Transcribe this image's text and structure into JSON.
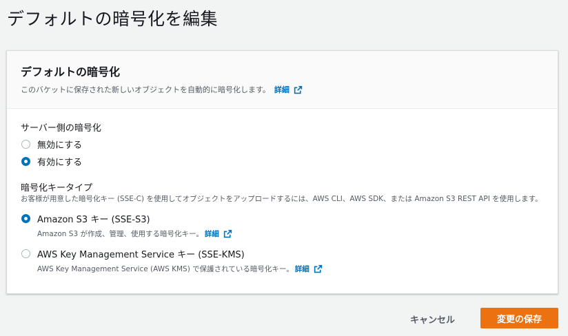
{
  "page": {
    "title": "デフォルトの暗号化を編集"
  },
  "panel": {
    "title": "デフォルトの暗号化",
    "description": "このバケットに保存された新しいオブジェクトを自動的に暗号化します。",
    "link_label": "詳細"
  },
  "server_side": {
    "label": "サーバー側の暗号化",
    "options": [
      {
        "label": "無効にする",
        "selected": false
      },
      {
        "label": "有効にする",
        "selected": true
      }
    ]
  },
  "key_type": {
    "label": "暗号化キータイプ",
    "description": "お客様が用意した暗号化キー (SSE-C) を使用してオブジェクトをアップロードするには、AWS CLI、AWS SDK、または Amazon S3 REST API を使用します。",
    "options": [
      {
        "label": "Amazon S3 キー (SSE-S3)",
        "description": "Amazon S3 が作成、管理、使用する暗号化キー。",
        "link_label": "詳細",
        "selected": true
      },
      {
        "label": "AWS Key Management Service キー (SSE-KMS)",
        "description": "AWS Key Management Service (AWS KMS) で保護されている暗号化キー。",
        "link_label": "詳細",
        "selected": false
      }
    ]
  },
  "footer": {
    "cancel_label": "キャンセル",
    "save_label": "変更の保存"
  },
  "colors": {
    "accent": "#0073bb",
    "primary_button": "#ec7211",
    "background": "#f2f3f3"
  },
  "icons": {
    "external_link": "external-link-icon"
  }
}
